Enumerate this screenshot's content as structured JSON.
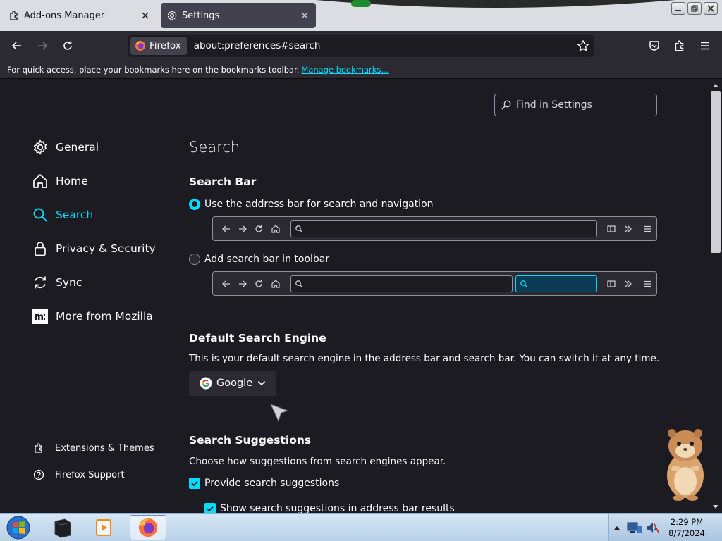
{
  "tabs": [
    {
      "label": "Add-ons Manager",
      "active": false
    },
    {
      "label": "Settings",
      "active": true
    }
  ],
  "navbar": {
    "identity_label": "Firefox",
    "url": "about:preferences#search"
  },
  "bookmarks_bar": {
    "message": "For quick access, place your bookmarks here on the bookmarks toolbar.",
    "link": "Manage bookmarks…"
  },
  "find": {
    "placeholder": "Find in Settings"
  },
  "sidebar": {
    "categories": [
      {
        "label": "General",
        "icon": "gear-icon"
      },
      {
        "label": "Home",
        "icon": "home-icon"
      },
      {
        "label": "Search",
        "icon": "search-icon",
        "selected": true
      },
      {
        "label": "Privacy & Security",
        "icon": "lock-icon"
      },
      {
        "label": "Sync",
        "icon": "sync-icon"
      },
      {
        "label": "More from Mozilla",
        "icon": "mozilla-icon"
      }
    ],
    "footer": [
      {
        "label": "Extensions & Themes",
        "icon": "puzzle-icon"
      },
      {
        "label": "Firefox Support",
        "icon": "help-icon"
      }
    ]
  },
  "main": {
    "title": "Search",
    "search_bar": {
      "heading": "Search Bar",
      "option_address": "Use the address bar for search and navigation",
      "option_toolbar": "Add search bar in toolbar",
      "selected": "address"
    },
    "default_engine": {
      "heading": "Default Search Engine",
      "description": "This is your default search engine in the address bar and search bar. You can switch it at any time.",
      "selected": "Google"
    },
    "suggestions": {
      "heading": "Search Suggestions",
      "description": "Choose how suggestions from search engines appear.",
      "provide": "Provide search suggestions",
      "show_in_address": "Show search suggestions in address bar results",
      "provide_checked": true,
      "show_checked": true
    }
  },
  "taskbar": {
    "time": "2:29 PM",
    "date": "8/7/2024"
  },
  "colors": {
    "accent": "#00ddff",
    "content_bg": "#1c1b22",
    "toolbar_bg": "#2b2a33"
  }
}
